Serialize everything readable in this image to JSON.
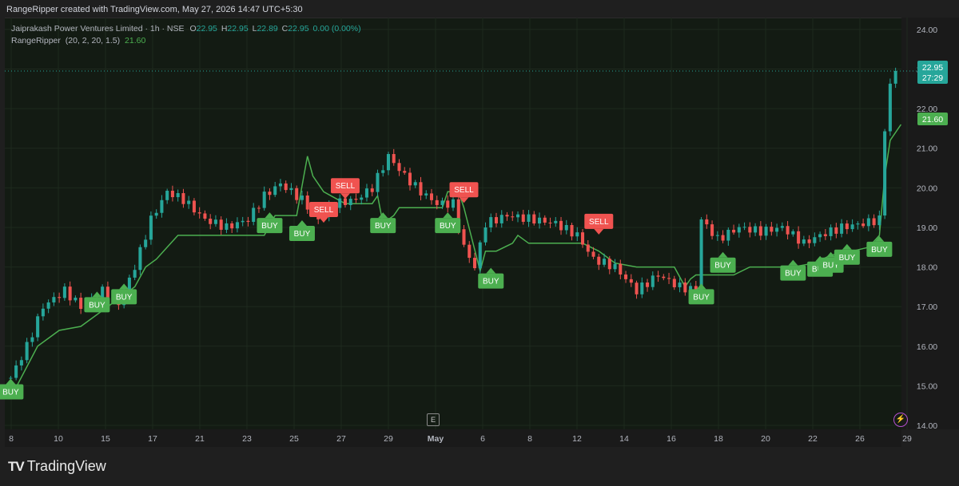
{
  "credit": "RangeRipper created with TradingView.com, May 27, 2026 14:47 UTC+5:30",
  "legend": {
    "symbol": "Jaiprakash Power Ventures Limited · 1h · NSE",
    "o_label": "O",
    "o": "22.95",
    "h_label": "H",
    "h": "22.95",
    "l_label": "L",
    "l": "22.89",
    "c_label": "C",
    "c": "22.95",
    "change": "0.00 (0.00%)",
    "indicator": "RangeRipper",
    "params": "(20, 2, 20, 1.5)",
    "value": "21.60"
  },
  "price_badge": {
    "price": "22.95",
    "countdown": "27:29"
  },
  "indicator_badge": "21.60",
  "brand": "TradingView",
  "e_button": "E",
  "colors": {
    "background": "#131b13",
    "up": "#26a69a",
    "down": "#ef5350",
    "indicator": "#4caf50",
    "buy": "#4caf50",
    "sell": "#f05350"
  },
  "chart_data": {
    "type": "candlestick",
    "timeframe": "1h",
    "ylim": [
      13.9,
      24.3
    ],
    "y_ticks": [
      "24.00",
      "23.00",
      "22.00",
      "21.00",
      "20.00",
      "19.00",
      "18.00",
      "17.00",
      "16.00",
      "15.00",
      "14.00"
    ],
    "x_ticks": [
      "8",
      "10",
      "15",
      "17",
      "21",
      "23",
      "25",
      "27",
      "29",
      "May",
      "6",
      "8",
      "12",
      "14",
      "16",
      "18",
      "20",
      "22",
      "26",
      "29"
    ],
    "bars": 165,
    "path_points": [
      [
        0,
        15.2
      ],
      [
        3,
        16.0
      ],
      [
        6,
        17.0
      ],
      [
        10,
        17.4
      ],
      [
        13,
        17.0
      ],
      [
        17,
        17.4
      ],
      [
        20,
        17.1
      ],
      [
        23,
        18.0
      ],
      [
        26,
        19.2
      ],
      [
        29,
        19.9
      ],
      [
        32,
        19.7
      ],
      [
        36,
        19.2
      ],
      [
        40,
        19.0
      ],
      [
        44,
        19.2
      ],
      [
        47,
        19.8
      ],
      [
        50,
        20.1
      ],
      [
        54,
        19.7
      ],
      [
        57,
        19.2
      ],
      [
        60,
        19.6
      ],
      [
        64,
        19.7
      ],
      [
        67,
        20.0
      ],
      [
        70,
        20.8
      ],
      [
        73,
        20.3
      ],
      [
        76,
        19.9
      ],
      [
        79,
        19.6
      ],
      [
        82,
        19.6
      ],
      [
        84,
        18.5
      ],
      [
        86,
        18.0
      ],
      [
        88,
        19.1
      ],
      [
        92,
        19.3
      ],
      [
        97,
        19.2
      ],
      [
        101,
        19.1
      ],
      [
        105,
        18.8
      ],
      [
        108,
        18.2
      ],
      [
        112,
        18.0
      ],
      [
        116,
        17.4
      ],
      [
        120,
        17.8
      ],
      [
        124,
        17.5
      ],
      [
        127,
        17.4
      ],
      [
        128,
        19.2
      ],
      [
        131,
        18.7
      ],
      [
        135,
        19.0
      ],
      [
        139,
        18.9
      ],
      [
        143,
        19.0
      ],
      [
        147,
        18.6
      ],
      [
        150,
        18.8
      ],
      [
        154,
        19.0
      ],
      [
        158,
        19.1
      ],
      [
        161,
        19.2
      ],
      [
        162,
        21.5
      ],
      [
        163,
        22.6
      ],
      [
        164,
        22.95
      ]
    ],
    "indicator_line": {
      "name": "RangeRipper",
      "points": [
        [
          0,
          14.7
        ],
        [
          5,
          16.0
        ],
        [
          9,
          16.4
        ],
        [
          13,
          16.5
        ],
        [
          17,
          16.9
        ],
        [
          20,
          17.2
        ],
        [
          23,
          17.5
        ],
        [
          25,
          18.0
        ],
        [
          27,
          18.2
        ],
        [
          29,
          18.5
        ],
        [
          31,
          18.8
        ],
        [
          47,
          18.8
        ],
        [
          49,
          19.3
        ],
        [
          53,
          19.3
        ],
        [
          55,
          20.8
        ],
        [
          56,
          20.3
        ],
        [
          58,
          19.9
        ],
        [
          62,
          19.6
        ],
        [
          67,
          19.6
        ],
        [
          68,
          19.8
        ],
        [
          69,
          19.1
        ],
        [
          71,
          19.3
        ],
        [
          72,
          19.5
        ],
        [
          80,
          19.5
        ],
        [
          81,
          19.9
        ],
        [
          83,
          19.9
        ],
        [
          84,
          19.5
        ],
        [
          87,
          17.9
        ],
        [
          88,
          18.4
        ],
        [
          90,
          18.4
        ],
        [
          93,
          18.6
        ],
        [
          94,
          18.8
        ],
        [
          96,
          18.6
        ],
        [
          106,
          18.6
        ],
        [
          109,
          18.4
        ],
        [
          112,
          18.1
        ],
        [
          116,
          18.0
        ],
        [
          123,
          18.0
        ],
        [
          125,
          17.5
        ],
        [
          126,
          17.7
        ],
        [
          127,
          17.8
        ],
        [
          134,
          17.8
        ],
        [
          137,
          18.0
        ],
        [
          145,
          18.0
        ],
        [
          149,
          18.1
        ],
        [
          152,
          18.3
        ],
        [
          156,
          18.4
        ],
        [
          159,
          18.5
        ],
        [
          161,
          18.8
        ],
        [
          162,
          20.3
        ],
        [
          163,
          21.2
        ],
        [
          165,
          21.6
        ]
      ]
    },
    "signals": [
      {
        "type": "BUY",
        "bar": 0,
        "price": 15.2
      },
      {
        "type": "BUY",
        "bar": 16,
        "price": 17.4
      },
      {
        "type": "BUY",
        "bar": 21,
        "price": 17.6
      },
      {
        "type": "BUY",
        "bar": 48,
        "price": 19.4
      },
      {
        "type": "BUY",
        "bar": 54,
        "price": 19.2
      },
      {
        "type": "SELL",
        "bar": 58,
        "price": 19.1
      },
      {
        "type": "SELL",
        "bar": 62,
        "price": 19.7
      },
      {
        "type": "BUY",
        "bar": 69,
        "price": 19.4
      },
      {
        "type": "BUY",
        "bar": 81,
        "price": 19.4
      },
      {
        "type": "SELL",
        "bar": 84,
        "price": 19.6
      },
      {
        "type": "BUY",
        "bar": 89,
        "price": 18.0
      },
      {
        "type": "SELL",
        "bar": 109,
        "price": 18.8
      },
      {
        "type": "BUY",
        "bar": 128,
        "price": 17.6
      },
      {
        "type": "BUY",
        "bar": 132,
        "price": 18.4
      },
      {
        "type": "BUY",
        "bar": 145,
        "price": 18.2
      },
      {
        "type": "BUY",
        "bar": 150,
        "price": 18.3
      },
      {
        "type": "BUY",
        "bar": 152,
        "price": 18.4
      },
      {
        "type": "BUY",
        "bar": 155,
        "price": 18.6
      },
      {
        "type": "BUY",
        "bar": 161,
        "price": 18.8
      }
    ],
    "last_price": 22.95,
    "grid": true
  }
}
